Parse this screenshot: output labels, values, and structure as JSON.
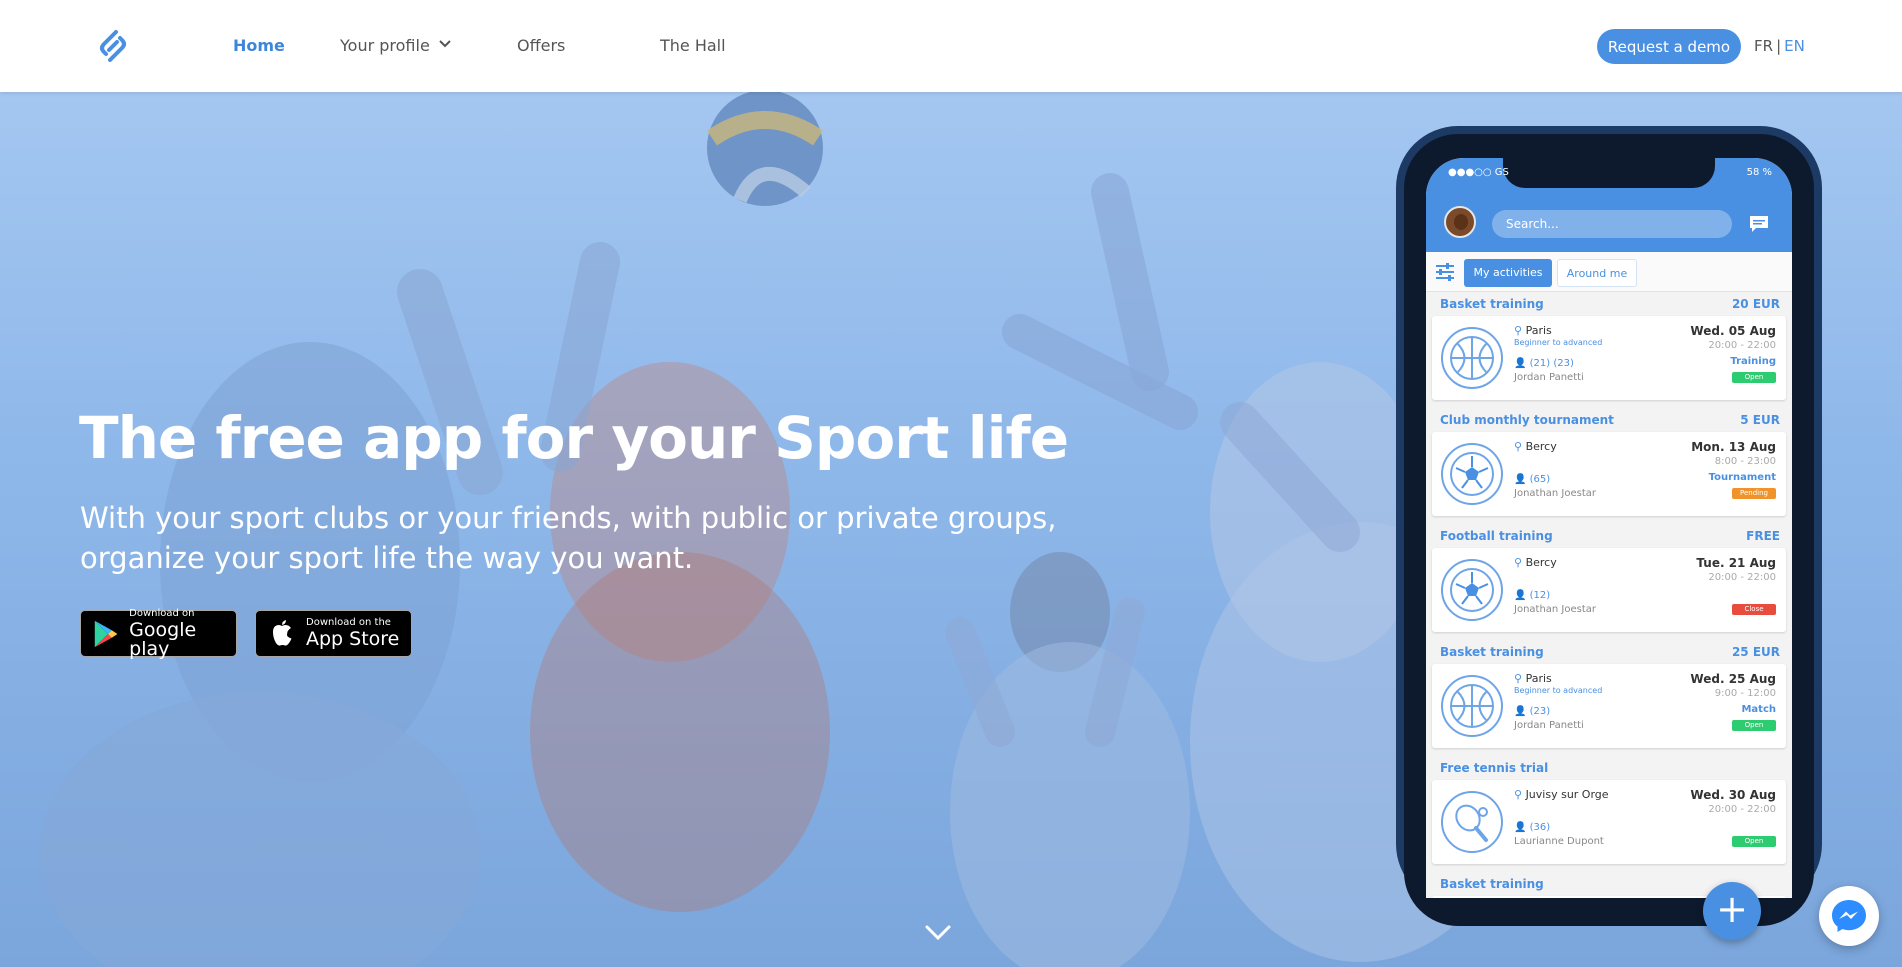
{
  "nav": {
    "home": "Home",
    "profile": "Your profile",
    "offers": "Offers",
    "hall": "The Hall",
    "demo": "Request a demo",
    "lang_fr": "FR",
    "lang_sep": "|",
    "lang_en": "EN"
  },
  "hero": {
    "title": "The free app for your Sport life",
    "subtitle": "With your sport clubs or your friends, with public or private groups, organize your sport life the way you want.",
    "google_small": "Download on",
    "google_big": "Google play",
    "apple_small": "Download on the",
    "apple_big": "App Store"
  },
  "phone": {
    "status_left": "●●●○○ GS",
    "status_right": "58 %",
    "search_placeholder": "Search...",
    "tab_mine": "My activities",
    "tab_around": "Around me",
    "activities": [
      {
        "title": "Basket training",
        "price": "20 EUR",
        "sport": "basketball",
        "place": "Paris",
        "level": "Beginner to advanced",
        "count": "(21)  (23)",
        "person": "Jordan Panetti",
        "date": "Wed. 05 Aug",
        "time": "20:00 - 22:00",
        "type": "Training",
        "status": "Open",
        "status_color": "#2ecc71"
      },
      {
        "title": "Club monthly tournament",
        "price": "5 EUR",
        "sport": "football",
        "place": "Bercy",
        "level": "",
        "count": "(65)",
        "person": "Jonathan Joestar",
        "date": "Mon. 13 Aug",
        "time": "8:00 - 23:00",
        "type": "Tournament",
        "status": "Pending",
        "status_color": "#f0932b"
      },
      {
        "title": "Football training",
        "price": "FREE",
        "sport": "football",
        "place": "Bercy",
        "level": "",
        "count": "(12)",
        "person": "Jonathan Joestar",
        "date": "Tue. 21 Aug",
        "time": "20:00 - 22:00",
        "type": "",
        "status": "Close",
        "status_color": "#e74c3c"
      },
      {
        "title": "Basket training",
        "price": "25 EUR",
        "sport": "basketball",
        "place": "Paris",
        "level": "Beginner to advanced",
        "count": "(23)",
        "person": "Jordan Panetti",
        "date": "Wed. 25 Aug",
        "time": "9:00 - 12:00",
        "type": "Match",
        "status": "Open",
        "status_color": "#2ecc71"
      },
      {
        "title": "Free tennis trial",
        "price": "",
        "sport": "tennis",
        "place": "Juvisy sur Orge",
        "level": "",
        "count": "(36)",
        "person": "Laurianne Dupont",
        "date": "Wed. 30 Aug",
        "time": "20:00 - 22:00",
        "type": "",
        "status": "Open",
        "status_color": "#2ecc71"
      },
      {
        "title": "Basket training",
        "price": "",
        "sport": "basketball",
        "place": "",
        "level": "",
        "count": "",
        "person": "",
        "date": "",
        "time": "",
        "type": "",
        "status": "",
        "status_color": ""
      }
    ],
    "fab": "+"
  },
  "colors": {
    "accent": "#4a90e2",
    "hero_bg": "#8fb8e8",
    "nav_bg": "#ffffff"
  },
  "icons": {
    "logo": "brand-logo-icon",
    "profile_menu": "chevron-down-icon",
    "scroll": "chevron-down-icon",
    "chat": "chat-icon",
    "filter": "sliders-icon",
    "messenger": "messenger-icon"
  }
}
